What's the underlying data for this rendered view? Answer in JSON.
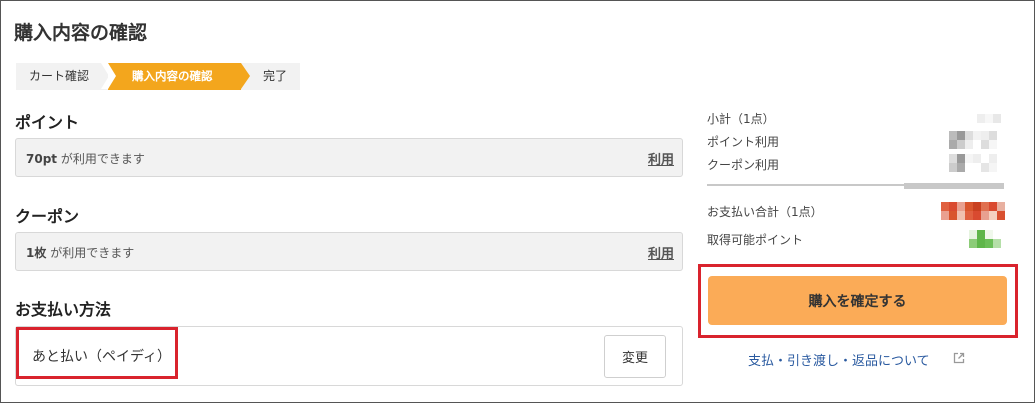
{
  "page": {
    "title": "購入内容の確認"
  },
  "steps": [
    "カート確認",
    "購入内容の確認",
    "完了"
  ],
  "points": {
    "heading": "ポイント",
    "value": "70pt",
    "suffix": "が利用できます",
    "action": "利用"
  },
  "coupon": {
    "heading": "クーポン",
    "value": "1枚",
    "suffix": "が利用できます",
    "action": "利用"
  },
  "payment": {
    "heading": "お支払い方法",
    "method": "あと払い（ペイディ）",
    "change_label": "変更"
  },
  "summary": {
    "subtotal_label": "小計（1点）",
    "point_use_label": "ポイント利用",
    "coupon_use_label": "クーポン利用",
    "total_label": "お支払い合計（1点）",
    "earn_points_label": "取得可能ポイント",
    "colors": {
      "total_redacted": "#d9552d",
      "points_redacted": "#5fb64a",
      "accent": "#f3a61d",
      "highlight": "#d9232d"
    }
  },
  "confirm": {
    "label": "購入を確定する"
  },
  "info_link": {
    "label": "支払・引き渡し・返品について",
    "icon": "external-link-icon"
  }
}
